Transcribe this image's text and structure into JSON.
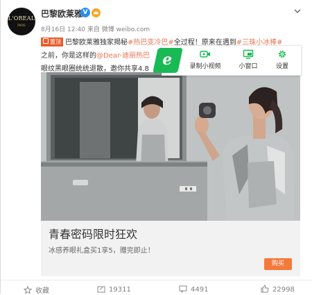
{
  "post": {
    "author": "巴黎欧莱雅",
    "avatar_brand": "L'OREAL",
    "avatar_sub": "PARIS",
    "verified_icon": "V",
    "vip_icon": "vip-crown",
    "time": "8月16日 12:40",
    "source": "来自 微博 weibo.com",
    "pin_label": "置顶",
    "line1_text_a": "巴黎欧莱雅独家揭秘",
    "line1_hashtag1": "#热巴变冷巴#",
    "line1_text_b": "全过程！原来在遇到",
    "line1_hashtag2": "#三珠小冰棒#",
    "line2_text_a": "之前，你是这样的",
    "line2_mention": "@Dear-迪丽热巴",
    "line3_text": "眼纹黑眼圈统统退散，邀你共享4.8"
  },
  "toolbar": {
    "logo_letter": "e",
    "record_label": "录制小视频",
    "window_label": "小窗口",
    "settings_label": "设置",
    "accent_color": "#19b955"
  },
  "ad": {
    "title": "青春密码限时狂欢",
    "description": "冰感养眼礼盒买1享5，赠完即止！",
    "buy_label": "购买",
    "button_color": "#f47a3c"
  },
  "actions": {
    "favorite_label": "收藏",
    "forward_count": "19311",
    "comment_count": "4491",
    "like_count": "22998"
  },
  "colors": {
    "hashtag": "#eb7350",
    "pin_bg": "#eb5c2d",
    "verified": "#2b8ef0"
  }
}
